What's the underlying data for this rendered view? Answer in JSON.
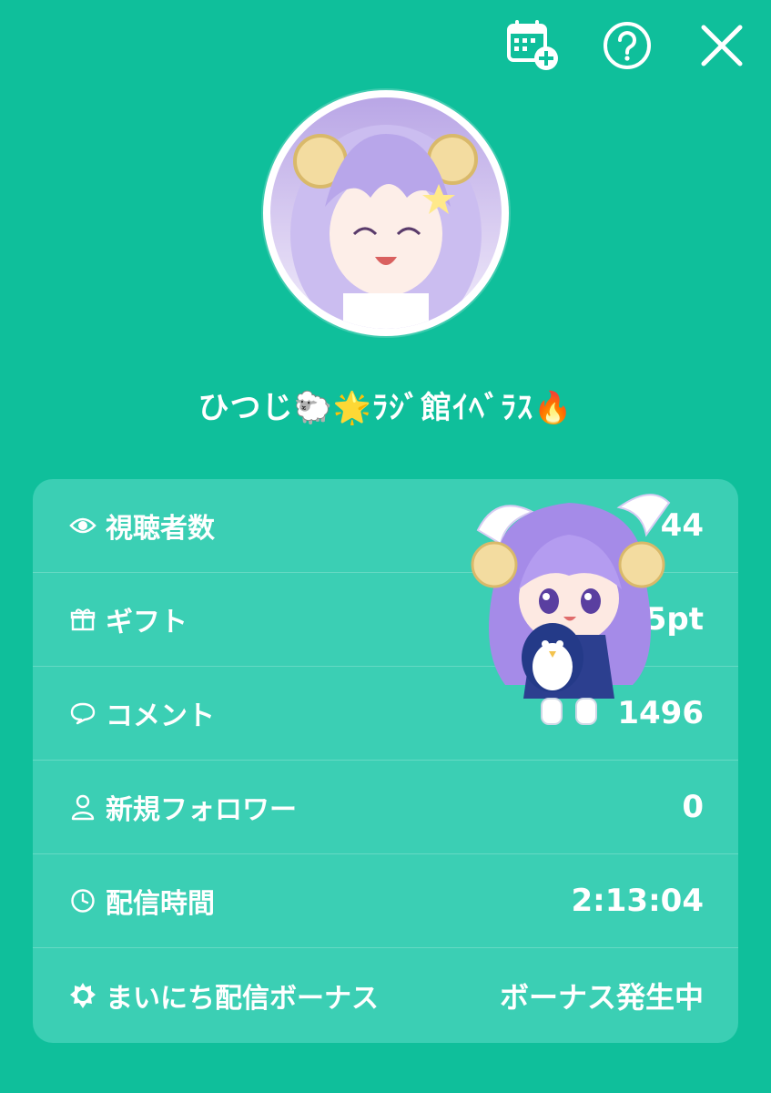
{
  "toolbar": {
    "calendar_icon": "calendar-add-icon",
    "help_icon": "help-icon",
    "close_icon": "close-icon"
  },
  "profile": {
    "avatar_alt": "avatar",
    "name": "ひつじ🐑🌟ﾗｼﾞ館ｲﾍﾞﾗｽ🔥"
  },
  "stats": [
    {
      "icon": "eye-icon",
      "label": "視聴者数",
      "value": "44"
    },
    {
      "icon": "gift-icon",
      "label": "ギフト",
      "value": "5pt"
    },
    {
      "icon": "comment-icon",
      "label": "コメント",
      "value": "1496"
    },
    {
      "icon": "person-icon",
      "label": "新規フォロワー",
      "value": "0"
    },
    {
      "icon": "clock-icon",
      "label": "配信時間",
      "value": "2:13:04"
    },
    {
      "icon": "sun-icon",
      "label": "まいにち配信ボーナス",
      "value": "ボーナス発生中"
    }
  ],
  "colors": {
    "background": "#0fbf9b",
    "panel": "#3bcfb4",
    "text": "#ffffff"
  }
}
